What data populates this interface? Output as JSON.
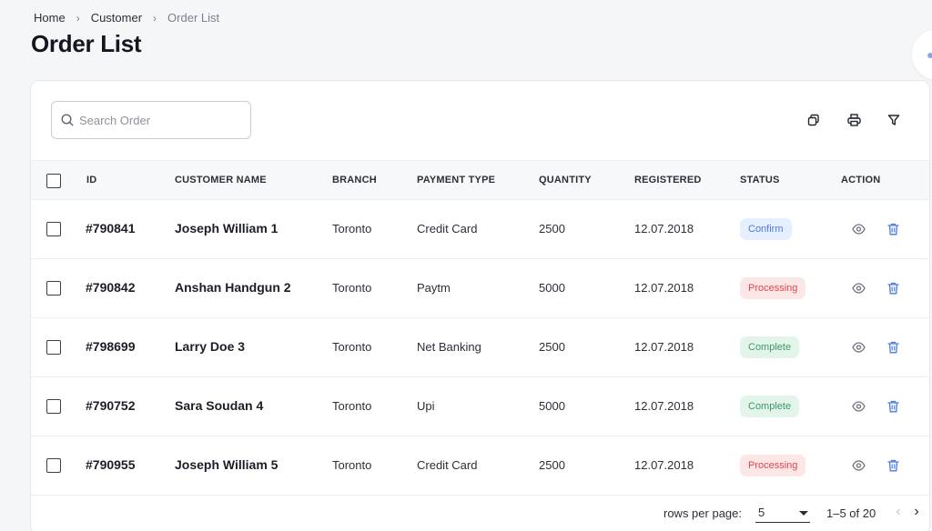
{
  "breadcrumb": {
    "items": [
      "Home",
      "Customer",
      "Order List"
    ]
  },
  "page_title": "Order List",
  "search": {
    "placeholder": "Search Order",
    "value": ""
  },
  "toolbar": {
    "icons": [
      "copy-icon",
      "print-icon",
      "filter-icon"
    ]
  },
  "table": {
    "columns": [
      "ID",
      "CUSTOMER NAME",
      "BRANCH",
      "PAYMENT TYPE",
      "QUANTITY",
      "REGISTERED",
      "STATUS",
      "ACTION"
    ],
    "rows": [
      {
        "id": "#790841",
        "customer": "Joseph William 1",
        "branch": "Toronto",
        "payment": "Credit Card",
        "quantity": "2500",
        "registered": "12.07.2018",
        "status": "Confirm",
        "status_type": "confirm"
      },
      {
        "id": "#790842",
        "customer": "Anshan Handgun 2",
        "branch": "Toronto",
        "payment": "Paytm",
        "quantity": "5000",
        "registered": "12.07.2018",
        "status": "Processing",
        "status_type": "processing"
      },
      {
        "id": "#798699",
        "customer": "Larry Doe 3",
        "branch": "Toronto",
        "payment": "Net Banking",
        "quantity": "2500",
        "registered": "12.07.2018",
        "status": "Complete",
        "status_type": "complete"
      },
      {
        "id": "#790752",
        "customer": "Sara Soudan 4",
        "branch": "Toronto",
        "payment": "Upi",
        "quantity": "5000",
        "registered": "12.07.2018",
        "status": "Complete",
        "status_type": "complete"
      },
      {
        "id": "#790955",
        "customer": "Joseph William 5",
        "branch": "Toronto",
        "payment": "Credit Card",
        "quantity": "2500",
        "registered": "12.07.2018",
        "status": "Processing",
        "status_type": "processing"
      }
    ]
  },
  "pagination": {
    "rows_per_page_label": "rows per page:",
    "rows_per_page": "5",
    "range": "1–5 of 20"
  },
  "colors": {
    "accent": "#4a7bdc",
    "confirm_bg": "#e6efff",
    "processing": "#e0454a",
    "complete": "#3c9a62"
  }
}
